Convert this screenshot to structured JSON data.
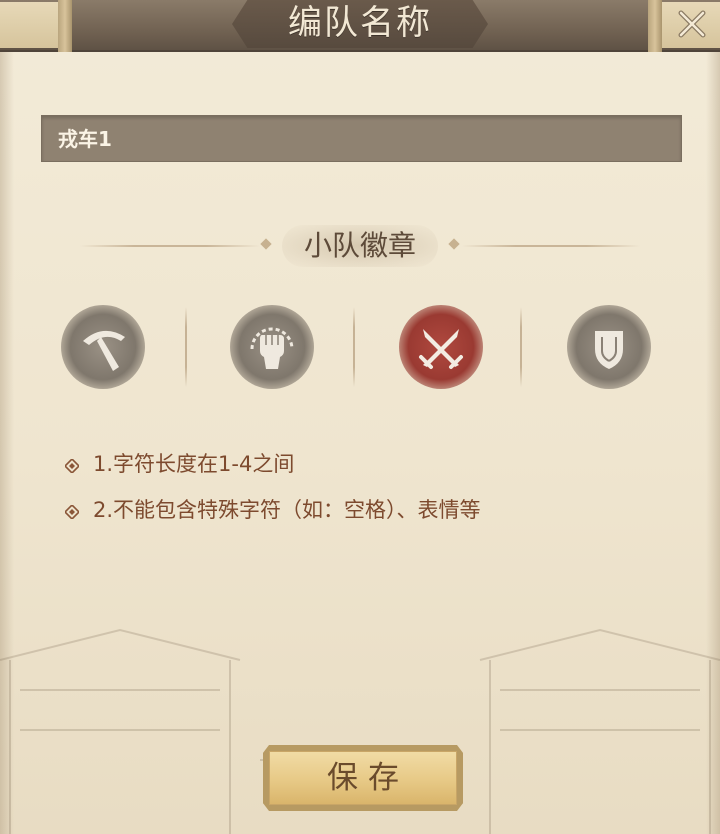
{
  "header": {
    "title": "编队名称",
    "close_icon": "close-icon"
  },
  "name_field": {
    "value": "戎车1"
  },
  "badge_section": {
    "title": "小队徽章",
    "emblems": [
      {
        "icon": "pickaxe-icon",
        "selected": false
      },
      {
        "icon": "fist-icon",
        "selected": false
      },
      {
        "icon": "crossed-swords-icon",
        "selected": true
      },
      {
        "icon": "shield-icon",
        "selected": false
      }
    ]
  },
  "rules": [
    "1.字符长度在1-4之间",
    "2.不能包含特殊字符（如：空格）、表情等"
  ],
  "save_button": {
    "label": "保存"
  },
  "colors": {
    "header": "#726353",
    "rule_text": "#7d4a2e",
    "selected_emblem": "#9a3a32",
    "button_face": "#e7c986"
  }
}
